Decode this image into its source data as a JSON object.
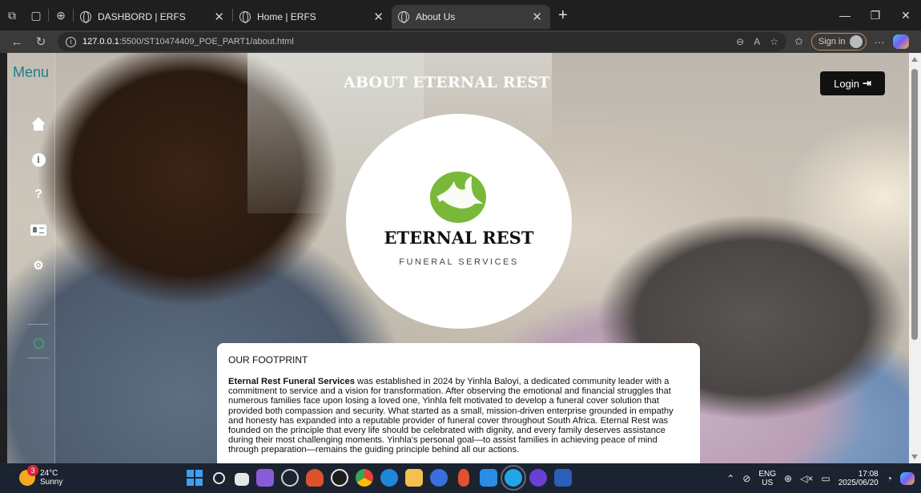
{
  "browser": {
    "tabs": [
      {
        "title": "DASHBORD | ERFS",
        "active": false
      },
      {
        "title": "Home | ERFS",
        "active": false
      },
      {
        "title": "About Us",
        "active": true
      }
    ],
    "url_host": "127.0.0.1",
    "url_path": ":5500/ST10474409_POE_PART1/about.html",
    "signin_label": "Sign in"
  },
  "sidebar": {
    "title": "Menu",
    "items": [
      {
        "icon": "home-icon"
      },
      {
        "icon": "info-icon"
      },
      {
        "icon": "question-icon",
        "glyph": "?"
      },
      {
        "icon": "contact-card-icon"
      },
      {
        "icon": "settings-gears-icon"
      }
    ],
    "social_icon": "whatsapp-icon"
  },
  "header": {
    "title": "ABOUT ETERNAL REST",
    "login_label": "Login",
    "login_icon": "login-arrow-icon"
  },
  "logo": {
    "name": "ETERNAL REST",
    "tagline": "FUNERAL SERVICES",
    "icon": "dove-icon",
    "accent_color": "#7ab83a"
  },
  "footprint": {
    "heading": "OUR FOOTPRINT",
    "bold_lead": "Eternal Rest Funeral Services",
    "body": " was established in 2024 by Yinhla Baloyi, a dedicated community leader with a commitment to service and a vision for transformation. After observing the emotional and financial struggles that numerous families face upon losing a loved one, Yinhla felt motivated to develop a funeral cover solution that provided both compassion and security. What started as a small, mission-driven enterprise grounded in empathy and honesty has expanded into a reputable provider of funeral cover throughout South Africa. Eternal Rest was founded on the principle that every life should be celebrated with dignity, and every family deserves assistance during their most challenging moments. Yinhla's personal goal—to assist families in achieving peace of mind through preparation—remains the guiding principle behind all our actions."
  },
  "taskbar": {
    "weather_temp": "24°C",
    "weather_desc": "Sunny",
    "notification_count": "3",
    "language_top": "ENG",
    "language_bottom": "US",
    "time": "17:08",
    "date": "2025/06/20"
  }
}
